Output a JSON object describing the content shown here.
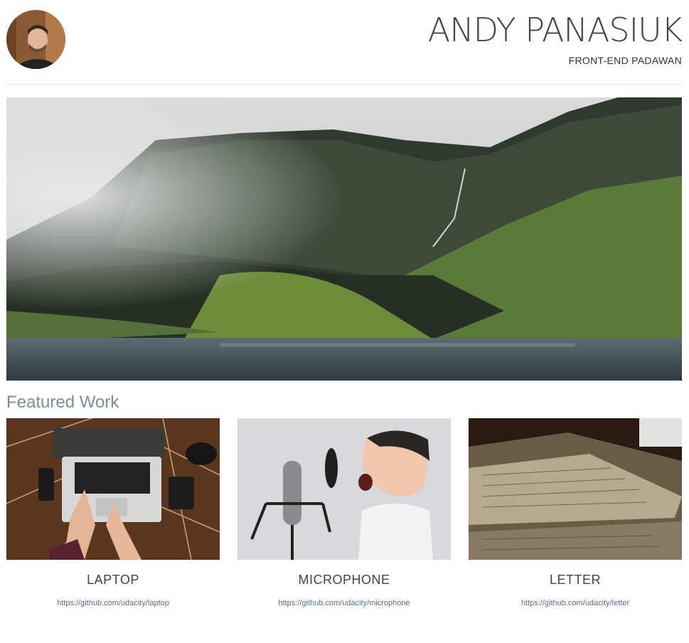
{
  "header": {
    "name": "ANDY PANASIUK",
    "subtitle": "FRONT-END PADAWAN"
  },
  "featured": {
    "title": "Featured Work",
    "items": [
      {
        "title": "LAPTOP",
        "link": "https://github.com/udacity/laptop"
      },
      {
        "title": "MICROPHONE",
        "link": "https://github.com/udacity/microphone"
      },
      {
        "title": "LETTER",
        "link": "https://github.com/udacity/letter"
      }
    ]
  },
  "colors": {
    "section_title": "#7f8c9b",
    "link": "#5a6e8c",
    "divider": "#e6e6e6"
  }
}
